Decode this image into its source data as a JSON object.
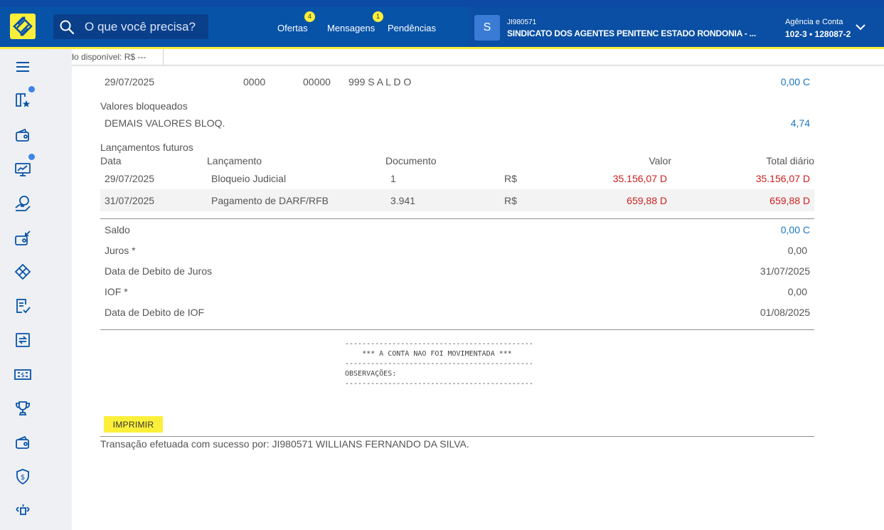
{
  "header": {
    "search_placeholder": "O que você precisa?",
    "nav": [
      {
        "label": "Ofertas",
        "badge": "4"
      },
      {
        "label": "Mensagens",
        "badge": "1"
      },
      {
        "label": "Pendências",
        "badge": ""
      }
    ],
    "user": {
      "avatar_letter": "S",
      "id": "JI980571",
      "name": "SINDICATO DOS AGENTES PENITENC ESTADO RONDONIA - ..."
    },
    "account": {
      "label": "Agência e Conta",
      "value": "102-3 • 128087-2"
    }
  },
  "saldo_disponivel": "Saldo disponível:  R$ ---",
  "sidebar": {
    "items": [
      "menu-icon",
      "favorites-icon",
      "wallet-icon",
      "investments-icon",
      "loans-icon",
      "wallet-receive-icon",
      "pix-icon",
      "document-check-icon",
      "transfer-icon",
      "cash-icon",
      "trophy-icon",
      "wallet-icon",
      "shield-icon",
      "more-icon"
    ]
  },
  "statement": {
    "saldo_row": {
      "date": "29/07/2025",
      "c1": "0000",
      "c2": "00000",
      "desc": "999 S A L D O",
      "value": "0,00 C"
    },
    "blocked": {
      "title": "Valores bloqueados",
      "label": "DEMAIS VALORES BLOQ.",
      "value": "4,74"
    },
    "future": {
      "title": "Lançamentos futuros",
      "headers": {
        "data": "Data",
        "lancamento": "Lançamento",
        "documento": "Documento",
        "valor": "Valor",
        "total": "Total diário"
      },
      "rows": [
        {
          "date": "29/07/2025",
          "desc": "Bloqueio Judicial",
          "doc": "1",
          "currency": "R$",
          "value": "35.156,07 D",
          "total": "35.156,07 D"
        },
        {
          "date": "31/07/2025",
          "desc": "Pagamento de DARF/RFB",
          "doc": "3.941",
          "currency": "R$",
          "value": "659,88 D",
          "total": "659,88 D"
        }
      ]
    },
    "summary": [
      {
        "label": "Saldo",
        "value": "0,00 C"
      },
      {
        "label": "Juros *",
        "value": "0,00"
      },
      {
        "label": "Data de Debito de Juros",
        "value": "31/07/2025"
      },
      {
        "label": "IOF *",
        "value": "0,00"
      },
      {
        "label": "Data de Debito de IOF",
        "value": "01/08/2025"
      }
    ],
    "notes": {
      "dashes": "--------------------------------------------",
      "line1": "    *** A CONTA NAO FOI MOVIMENTADA ***",
      "line2": "OBSERVAÇÕES:"
    },
    "print_label": "IMPRIMIR",
    "footer": "Transação efetuada com sucesso por: JI980571 WILLIANS FERNANDO DA SILVA."
  },
  "colors": {
    "brand_blue": "#0753a8",
    "brand_yellow": "#fcef3a",
    "debit_red": "#cc1f1f",
    "credit_blue": "#1a76c2"
  }
}
